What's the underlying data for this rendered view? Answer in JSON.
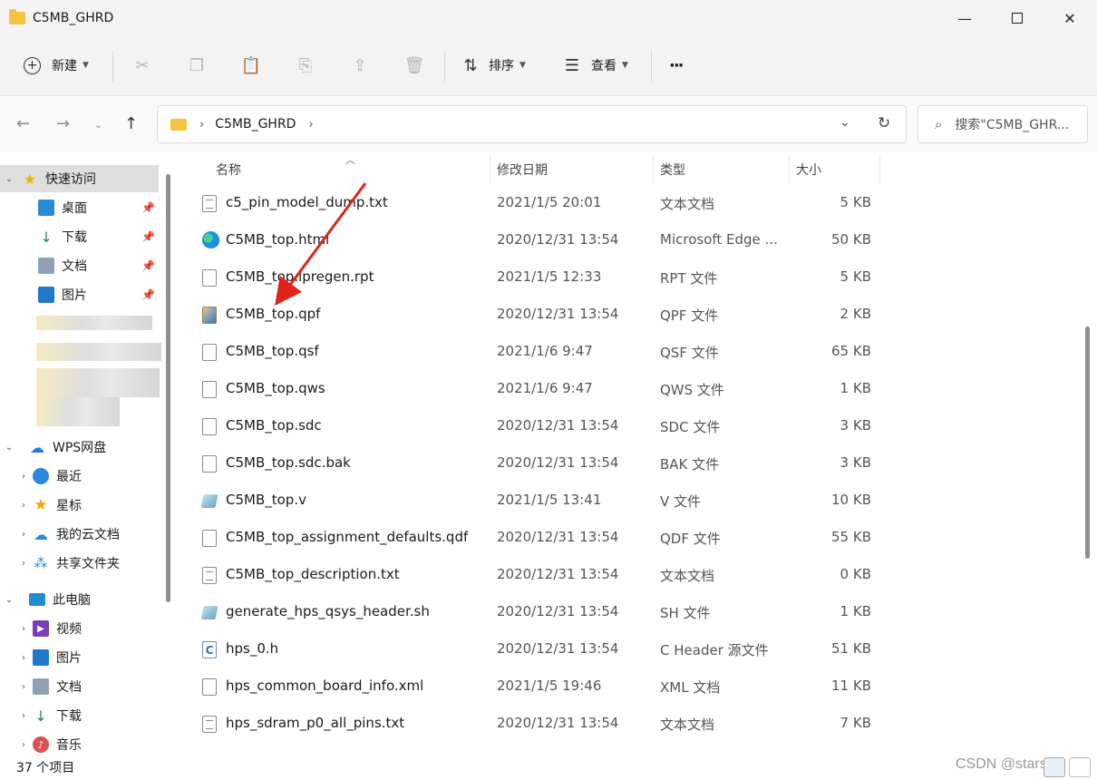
{
  "window": {
    "title": "C5MB_GHRD"
  },
  "toolbar": {
    "new_label": "新建",
    "sort_label": "排序",
    "view_label": "查看",
    "more_label": "···"
  },
  "address": {
    "segment": "C5MB_GHRD"
  },
  "search": {
    "placeholder": "搜索\"C5MB_GHR..."
  },
  "sidebar": {
    "quick_access": "快速访问",
    "quick_items": [
      "桌面",
      "下载",
      "文档",
      "图片"
    ],
    "wps": "WPS网盘",
    "wps_items": [
      "最近",
      "星标",
      "我的云文档",
      "共享文件夹"
    ],
    "pc": "此电脑",
    "pc_items": [
      "视频",
      "图片",
      "文档",
      "下载",
      "音乐"
    ]
  },
  "columns": {
    "name": "名称",
    "date": "修改日期",
    "type": "类型",
    "size": "大小"
  },
  "files": [
    {
      "name": "c5_pin_model_dump.txt",
      "date": "2021/1/5 20:01",
      "type": "文本文档",
      "size": "5 KB",
      "icon": "text-file-icon"
    },
    {
      "name": "C5MB_top.html",
      "date": "2020/12/31 13:54",
      "type": "Microsoft Edge ...",
      "size": "50 KB",
      "icon": "edge-icon"
    },
    {
      "name": "C5MB_top.ipregen.rpt",
      "date": "2021/1/5 12:33",
      "type": "RPT 文件",
      "size": "5 KB",
      "icon": "file-icon"
    },
    {
      "name": "C5MB_top.qpf",
      "date": "2020/12/31 13:54",
      "type": "QPF 文件",
      "size": "2 KB",
      "icon": "quartus-project-icon"
    },
    {
      "name": "C5MB_top.qsf",
      "date": "2021/1/6 9:47",
      "type": "QSF 文件",
      "size": "65 KB",
      "icon": "file-icon"
    },
    {
      "name": "C5MB_top.qws",
      "date": "2021/1/6 9:47",
      "type": "QWS 文件",
      "size": "1 KB",
      "icon": "file-icon"
    },
    {
      "name": "C5MB_top.sdc",
      "date": "2020/12/31 13:54",
      "type": "SDC 文件",
      "size": "3 KB",
      "icon": "file-icon"
    },
    {
      "name": "C5MB_top.sdc.bak",
      "date": "2020/12/31 13:54",
      "type": "BAK 文件",
      "size": "3 KB",
      "icon": "file-icon"
    },
    {
      "name": "C5MB_top.v",
      "date": "2021/1/5 13:41",
      "type": "V 文件",
      "size": "10 KB",
      "icon": "verilog-file-icon"
    },
    {
      "name": "C5MB_top_assignment_defaults.qdf",
      "date": "2020/12/31 13:54",
      "type": "QDF 文件",
      "size": "55 KB",
      "icon": "file-icon"
    },
    {
      "name": "C5MB_top_description.txt",
      "date": "2020/12/31 13:54",
      "type": "文本文档",
      "size": "0 KB",
      "icon": "text-file-icon"
    },
    {
      "name": "generate_hps_qsys_header.sh",
      "date": "2020/12/31 13:54",
      "type": "SH 文件",
      "size": "1 KB",
      "icon": "script-file-icon"
    },
    {
      "name": "hps_0.h",
      "date": "2020/12/31 13:54",
      "type": "C Header 源文件",
      "size": "51 KB",
      "icon": "c-header-icon"
    },
    {
      "name": "hps_common_board_info.xml",
      "date": "2021/1/5 19:46",
      "type": "XML 文档",
      "size": "11 KB",
      "icon": "file-icon"
    },
    {
      "name": "hps_sdram_p0_all_pins.txt",
      "date": "2020/12/31 13:54",
      "type": "文本文档",
      "size": "7 KB",
      "icon": "text-file-icon"
    }
  ],
  "status": {
    "count": "37 个项目"
  },
  "watermark": "CSDN @stars"
}
